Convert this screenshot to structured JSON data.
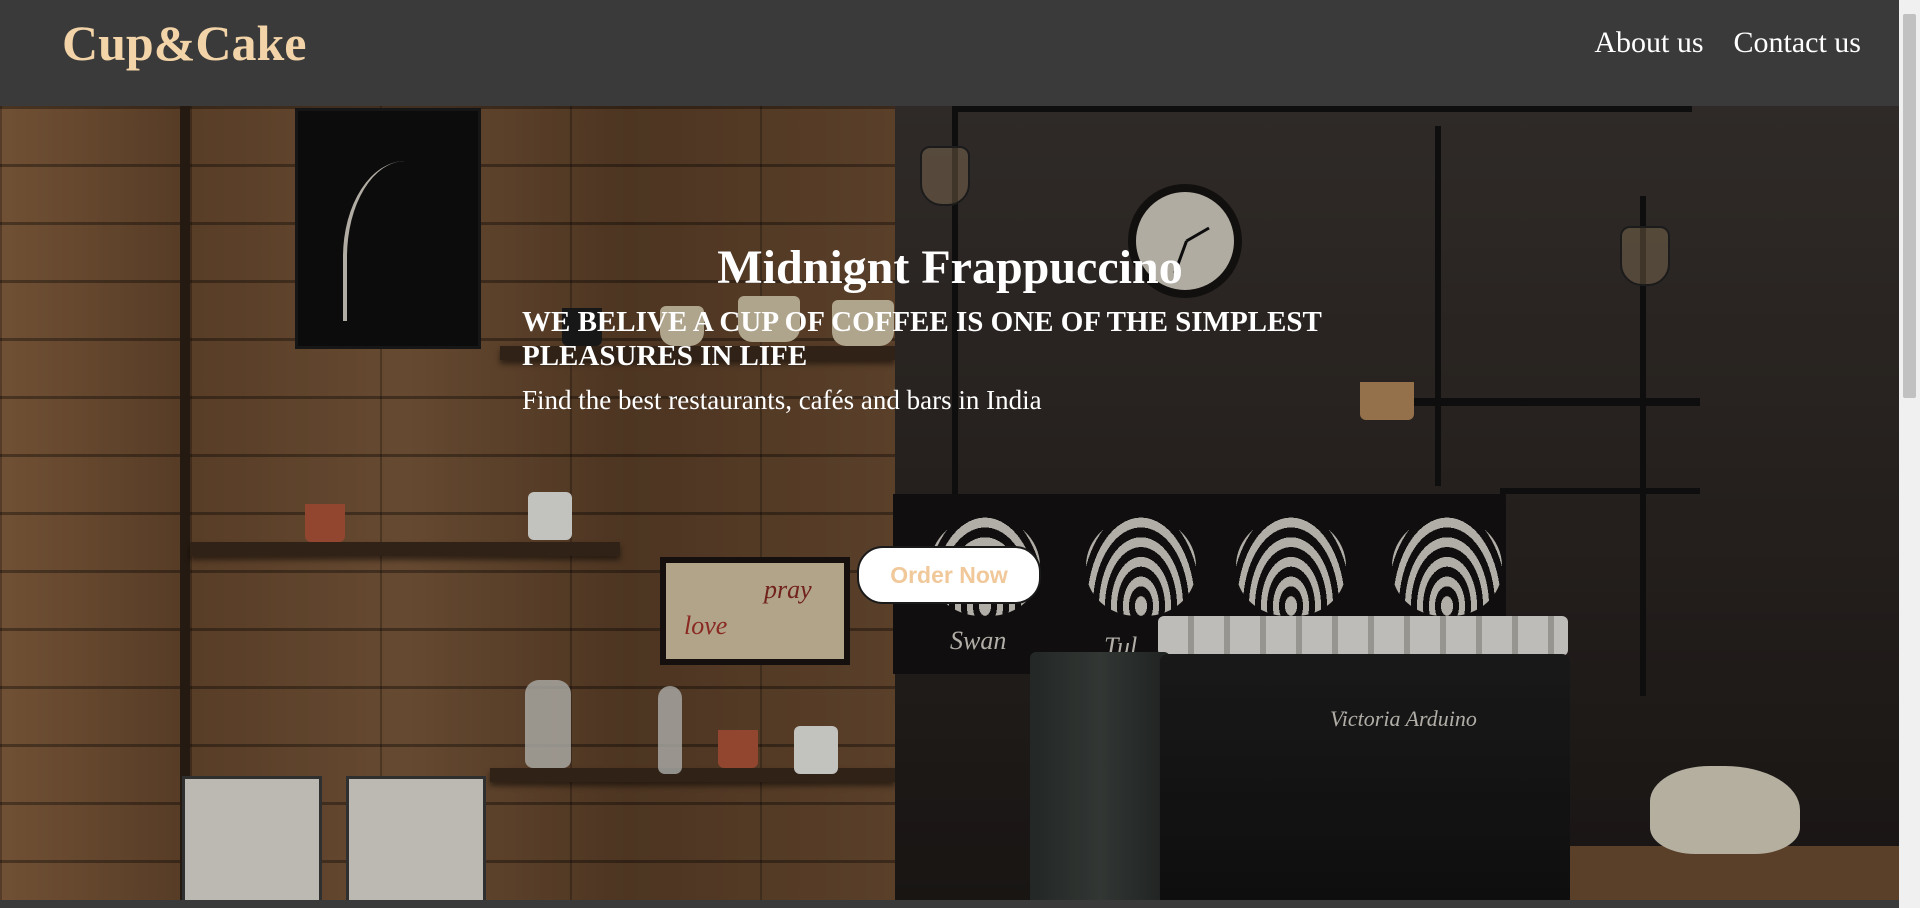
{
  "navbar": {
    "brand": "Cup&Cake",
    "links": [
      {
        "label": "About us"
      },
      {
        "label": "Contact us"
      }
    ]
  },
  "hero": {
    "title": "Midnignt Frappuccino",
    "subtitle": "WE BELIVE A CUP OF COFFEE IS ONE OF THE SIMPLEST PLEASURES IN LIFE",
    "text": "Find the best restaurants, cafés and bars in India",
    "button_label": "Order Now",
    "background_scene": {
      "board_words": [
        "Swan",
        "Tul"
      ],
      "sign_words": [
        "pray",
        "love"
      ],
      "machine_brand": "Victoria Arduino"
    }
  },
  "colors": {
    "navbar_bg": "#3a3a3a",
    "brand": "#f3d4a8",
    "button_text": "#f0c89a"
  }
}
